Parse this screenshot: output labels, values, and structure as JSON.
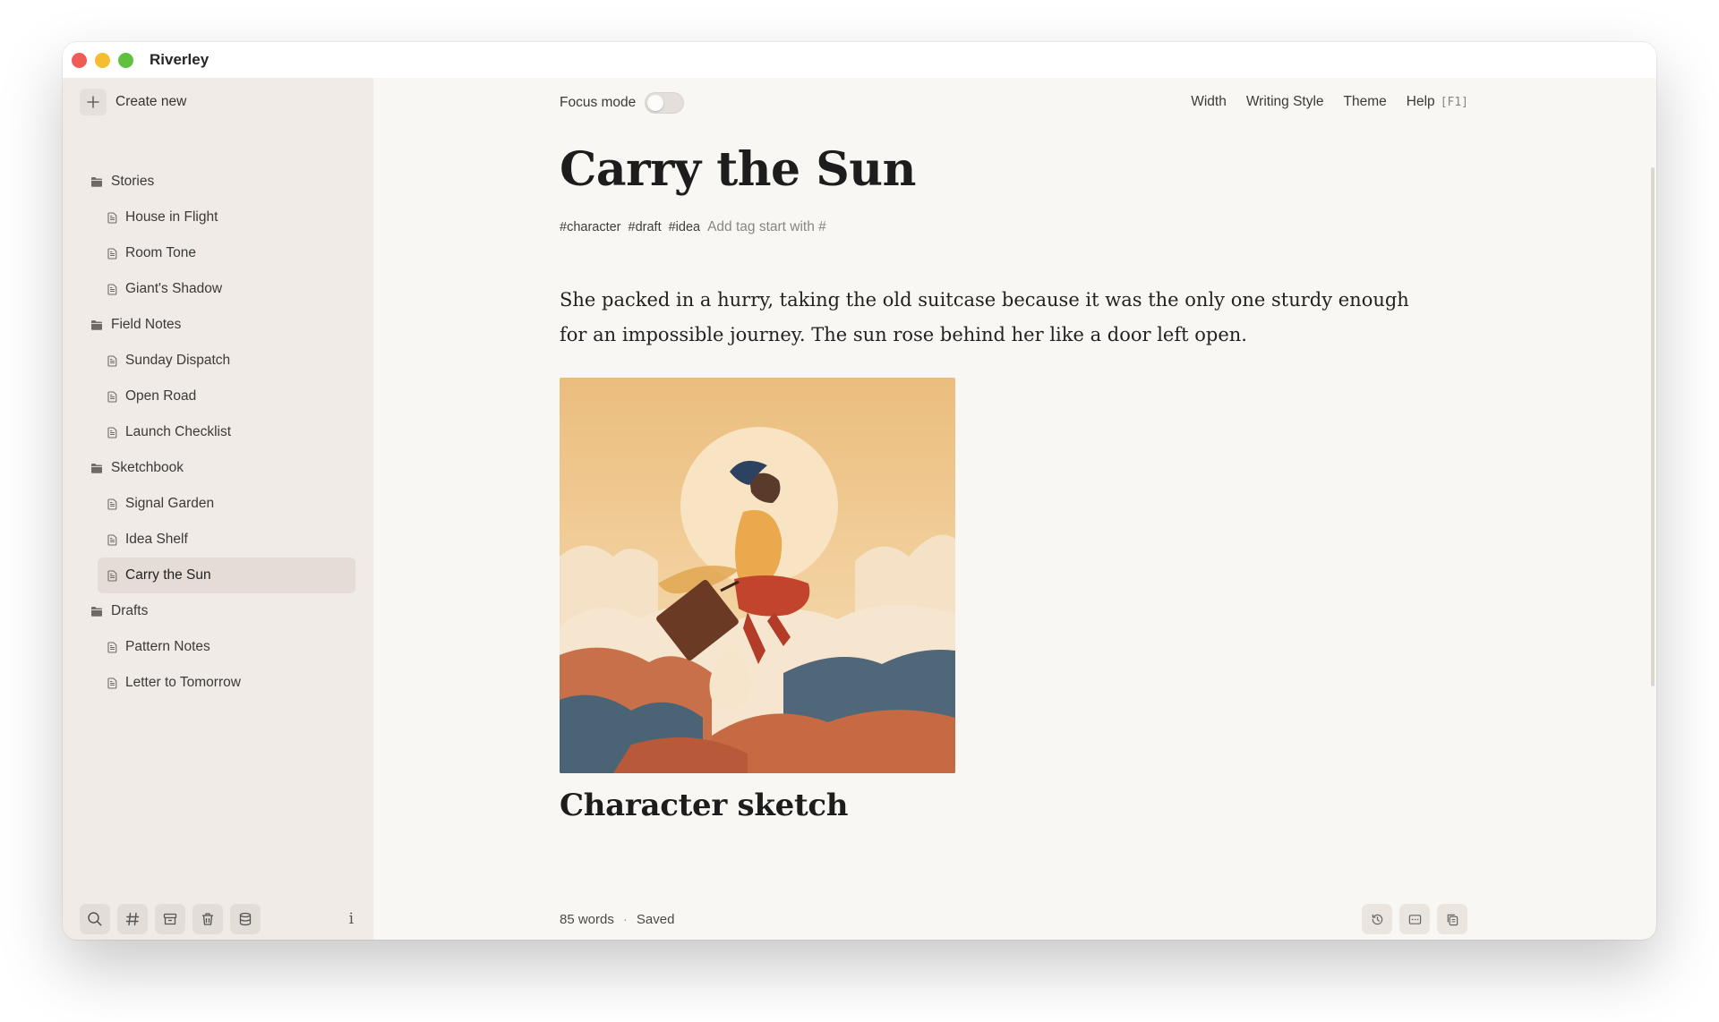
{
  "app": {
    "title": "Riverley"
  },
  "sidebar": {
    "create_label": "Create new",
    "tree": [
      {
        "folder": "Stories",
        "notes": [
          "House in Flight",
          "Room Tone",
          "Giant's Shadow"
        ]
      },
      {
        "folder": "Field Notes",
        "notes": [
          "Sunday Dispatch",
          "Open Road",
          "Launch Checklist"
        ]
      },
      {
        "folder": "Sketchbook",
        "notes": [
          "Signal Garden",
          "Idea Shelf",
          "Carry the Sun"
        ]
      },
      {
        "folder": "Drafts",
        "notes": [
          "Pattern Notes",
          "Letter to Tomorrow"
        ]
      }
    ],
    "active_note": "Carry the Sun",
    "footer_icons": [
      "search-icon",
      "hash-icon",
      "archive-icon",
      "trash-icon",
      "database-icon",
      "info-icon"
    ],
    "info_glyph": "i"
  },
  "toolbar": {
    "focus_label": "Focus mode",
    "focus_on": false,
    "menu": [
      "Width",
      "Writing Style",
      "Theme",
      "Help"
    ],
    "help_shortcut": "[F1]"
  },
  "document": {
    "title": "Carry the Sun",
    "tags": [
      "#character",
      "#draft",
      "#idea"
    ],
    "tag_placeholder": "Add tag start with #",
    "paragraph": "She packed in a hurry, taking the old suitcase because it was the only one sturdy enough for an impossible journey. The sun rose behind her like a door left open.",
    "heading": "Character sketch"
  },
  "status": {
    "word_count": "85 words",
    "separator": "·",
    "save_state": "Saved",
    "action_icons": [
      "history-icon",
      "preview-icon",
      "copy-icon"
    ]
  },
  "colors": {
    "background": "#f9f7f4",
    "sidebar": "#f0ebe6",
    "active_item": "#e5ddd5",
    "close": "#ee5c55",
    "minimize": "#f5bd2f",
    "zoom": "#5fc23f"
  }
}
